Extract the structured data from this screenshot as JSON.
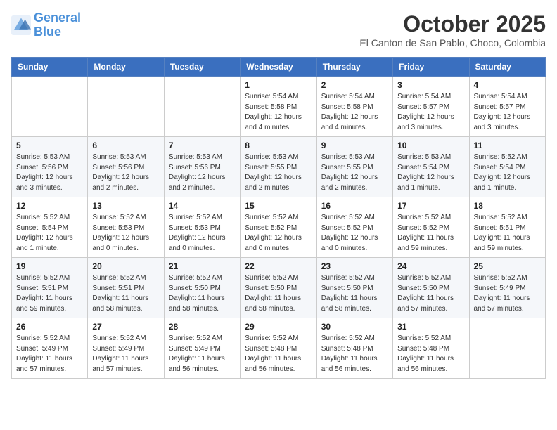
{
  "header": {
    "logo_line1": "General",
    "logo_line2": "Blue",
    "month": "October 2025",
    "location": "El Canton de San Pablo, Choco, Colombia"
  },
  "days_of_week": [
    "Sunday",
    "Monday",
    "Tuesday",
    "Wednesday",
    "Thursday",
    "Friday",
    "Saturday"
  ],
  "weeks": [
    [
      {
        "day": "",
        "info": ""
      },
      {
        "day": "",
        "info": ""
      },
      {
        "day": "",
        "info": ""
      },
      {
        "day": "1",
        "info": "Sunrise: 5:54 AM\nSunset: 5:58 PM\nDaylight: 12 hours\nand 4 minutes."
      },
      {
        "day": "2",
        "info": "Sunrise: 5:54 AM\nSunset: 5:58 PM\nDaylight: 12 hours\nand 4 minutes."
      },
      {
        "day": "3",
        "info": "Sunrise: 5:54 AM\nSunset: 5:57 PM\nDaylight: 12 hours\nand 3 minutes."
      },
      {
        "day": "4",
        "info": "Sunrise: 5:54 AM\nSunset: 5:57 PM\nDaylight: 12 hours\nand 3 minutes."
      }
    ],
    [
      {
        "day": "5",
        "info": "Sunrise: 5:53 AM\nSunset: 5:56 PM\nDaylight: 12 hours\nand 3 minutes."
      },
      {
        "day": "6",
        "info": "Sunrise: 5:53 AM\nSunset: 5:56 PM\nDaylight: 12 hours\nand 2 minutes."
      },
      {
        "day": "7",
        "info": "Sunrise: 5:53 AM\nSunset: 5:56 PM\nDaylight: 12 hours\nand 2 minutes."
      },
      {
        "day": "8",
        "info": "Sunrise: 5:53 AM\nSunset: 5:55 PM\nDaylight: 12 hours\nand 2 minutes."
      },
      {
        "day": "9",
        "info": "Sunrise: 5:53 AM\nSunset: 5:55 PM\nDaylight: 12 hours\nand 2 minutes."
      },
      {
        "day": "10",
        "info": "Sunrise: 5:53 AM\nSunset: 5:54 PM\nDaylight: 12 hours\nand 1 minute."
      },
      {
        "day": "11",
        "info": "Sunrise: 5:52 AM\nSunset: 5:54 PM\nDaylight: 12 hours\nand 1 minute."
      }
    ],
    [
      {
        "day": "12",
        "info": "Sunrise: 5:52 AM\nSunset: 5:54 PM\nDaylight: 12 hours\nand 1 minute."
      },
      {
        "day": "13",
        "info": "Sunrise: 5:52 AM\nSunset: 5:53 PM\nDaylight: 12 hours\nand 0 minutes."
      },
      {
        "day": "14",
        "info": "Sunrise: 5:52 AM\nSunset: 5:53 PM\nDaylight: 12 hours\nand 0 minutes."
      },
      {
        "day": "15",
        "info": "Sunrise: 5:52 AM\nSunset: 5:52 PM\nDaylight: 12 hours\nand 0 minutes."
      },
      {
        "day": "16",
        "info": "Sunrise: 5:52 AM\nSunset: 5:52 PM\nDaylight: 12 hours\nand 0 minutes."
      },
      {
        "day": "17",
        "info": "Sunrise: 5:52 AM\nSunset: 5:52 PM\nDaylight: 11 hours\nand 59 minutes."
      },
      {
        "day": "18",
        "info": "Sunrise: 5:52 AM\nSunset: 5:51 PM\nDaylight: 11 hours\nand 59 minutes."
      }
    ],
    [
      {
        "day": "19",
        "info": "Sunrise: 5:52 AM\nSunset: 5:51 PM\nDaylight: 11 hours\nand 59 minutes."
      },
      {
        "day": "20",
        "info": "Sunrise: 5:52 AM\nSunset: 5:51 PM\nDaylight: 11 hours\nand 58 minutes."
      },
      {
        "day": "21",
        "info": "Sunrise: 5:52 AM\nSunset: 5:50 PM\nDaylight: 11 hours\nand 58 minutes."
      },
      {
        "day": "22",
        "info": "Sunrise: 5:52 AM\nSunset: 5:50 PM\nDaylight: 11 hours\nand 58 minutes."
      },
      {
        "day": "23",
        "info": "Sunrise: 5:52 AM\nSunset: 5:50 PM\nDaylight: 11 hours\nand 58 minutes."
      },
      {
        "day": "24",
        "info": "Sunrise: 5:52 AM\nSunset: 5:50 PM\nDaylight: 11 hours\nand 57 minutes."
      },
      {
        "day": "25",
        "info": "Sunrise: 5:52 AM\nSunset: 5:49 PM\nDaylight: 11 hours\nand 57 minutes."
      }
    ],
    [
      {
        "day": "26",
        "info": "Sunrise: 5:52 AM\nSunset: 5:49 PM\nDaylight: 11 hours\nand 57 minutes."
      },
      {
        "day": "27",
        "info": "Sunrise: 5:52 AM\nSunset: 5:49 PM\nDaylight: 11 hours\nand 57 minutes."
      },
      {
        "day": "28",
        "info": "Sunrise: 5:52 AM\nSunset: 5:49 PM\nDaylight: 11 hours\nand 56 minutes."
      },
      {
        "day": "29",
        "info": "Sunrise: 5:52 AM\nSunset: 5:48 PM\nDaylight: 11 hours\nand 56 minutes."
      },
      {
        "day": "30",
        "info": "Sunrise: 5:52 AM\nSunset: 5:48 PM\nDaylight: 11 hours\nand 56 minutes."
      },
      {
        "day": "31",
        "info": "Sunrise: 5:52 AM\nSunset: 5:48 PM\nDaylight: 11 hours\nand 56 minutes."
      },
      {
        "day": "",
        "info": ""
      }
    ]
  ]
}
